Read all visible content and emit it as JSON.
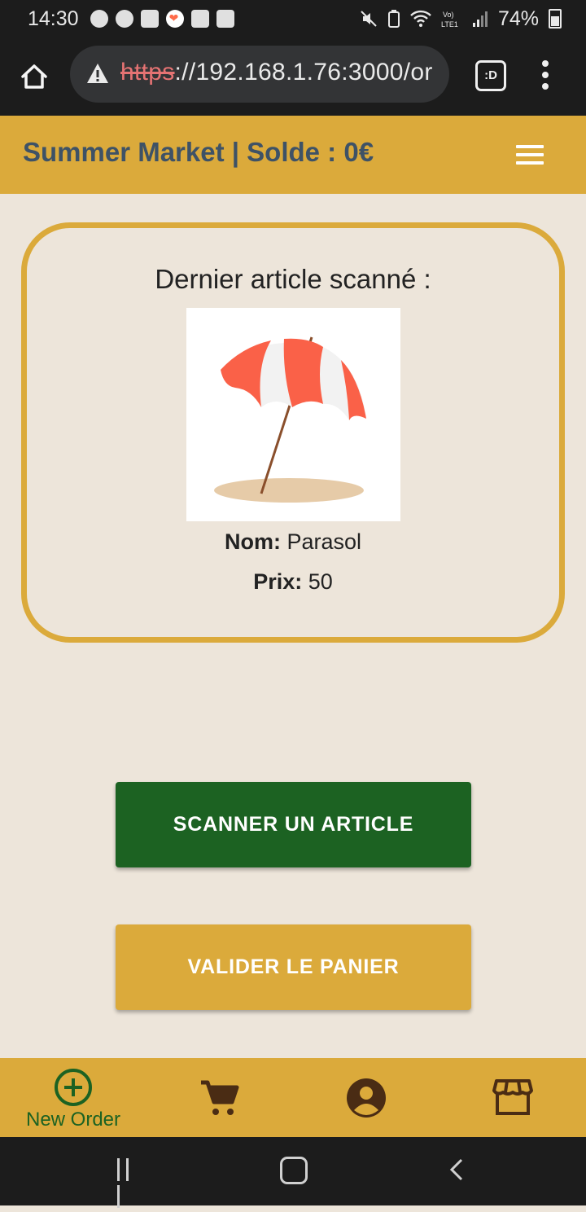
{
  "status_bar": {
    "time": "14:30",
    "battery": "74%",
    "icons": [
      "notification-icon",
      "notification-icon",
      "voicemail-icon",
      "heart-app-icon",
      "check-icon",
      "image-icon",
      "mute-icon",
      "battery-saver-icon",
      "wifi-icon",
      "volte-icon",
      "signal-icon",
      "battery-icon"
    ]
  },
  "browser": {
    "url_scheme": "https",
    "url_rest": "://192.168.1.76:3000/or",
    "tabs_label": ":D"
  },
  "header": {
    "title": "Summer Market | Solde : 0€"
  },
  "card": {
    "title": "Dernier article scanné :",
    "nom_label": "Nom:",
    "nom_value": "Parasol",
    "prix_label": "Prix:",
    "prix_value": "50"
  },
  "actions": {
    "scan_label": "SCANNER UN ARTICLE",
    "validate_label": "VALIDER LE PANIER"
  },
  "bottom_nav": {
    "items": [
      {
        "label": "New Order",
        "icon": "add-circle-icon",
        "active": true
      },
      {
        "label": "",
        "icon": "cart-icon",
        "active": false
      },
      {
        "label": "",
        "icon": "account-icon",
        "active": false
      },
      {
        "label": "",
        "icon": "store-icon",
        "active": false
      }
    ]
  },
  "colors": {
    "accent": "#dbaa3b",
    "primary_green": "#1c6222",
    "background": "#ede5da",
    "title_text": "#3e5266"
  }
}
